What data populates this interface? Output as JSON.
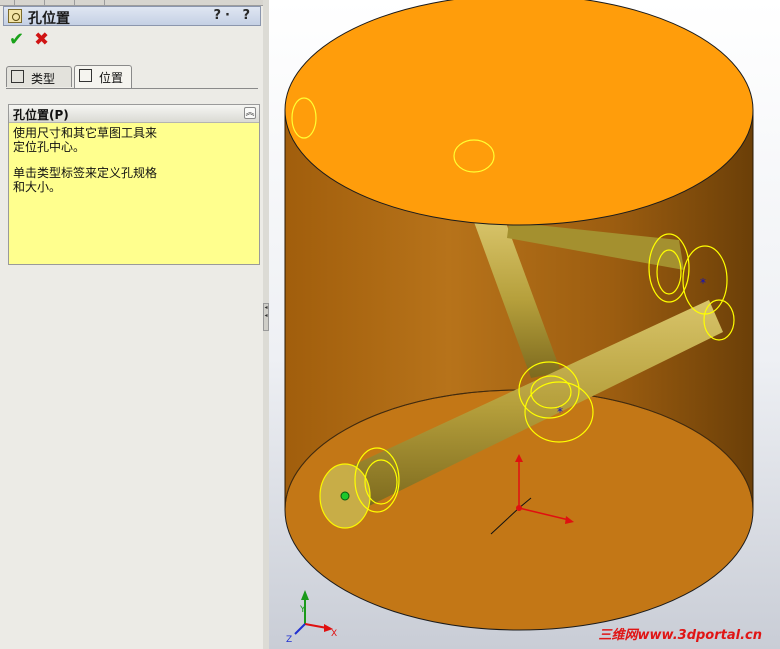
{
  "property_manager": {
    "title": "孔位置",
    "help_icons": "?· ?",
    "ok_label": "✔",
    "cancel_label": "✖",
    "tabs": [
      {
        "label": "类型",
        "active": false
      },
      {
        "label": "位置",
        "active": true
      }
    ],
    "section": {
      "header": "孔位置(P)",
      "collapse_glyph": "︽",
      "message_line1": "使用尺寸和其它草图工具来",
      "message_line2": "定位孔中心。",
      "message_line3": "单击类型标签来定义孔规格",
      "message_line4": "和大小。"
    }
  },
  "viewport": {
    "triad_x": "X",
    "triad_y": "Y",
    "triad_z": "Z",
    "watermark": "三维网www.3dportal.cn"
  },
  "colors": {
    "top_face": "#ff9d0b",
    "cylinder_body": "#b06c12",
    "pipe": "#b9a23c",
    "edge_highlight": "#ffff00",
    "section_bg": "#ffff8e"
  }
}
